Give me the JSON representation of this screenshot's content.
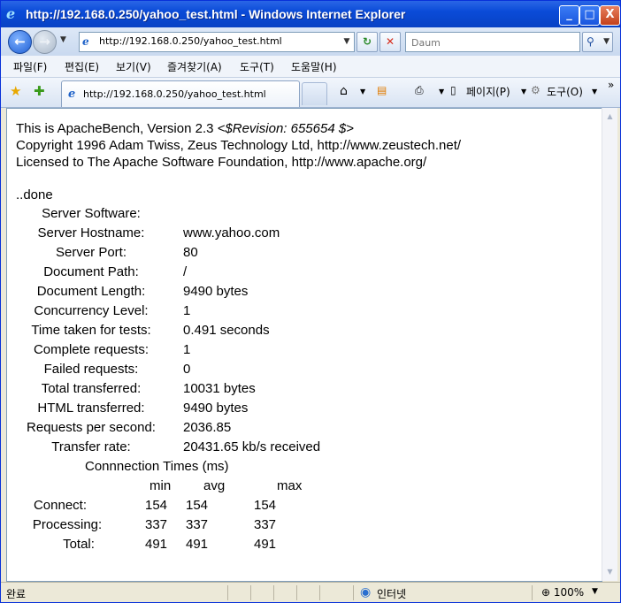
{
  "window": {
    "title": "http://192.168.0.250/yahoo_test.html - Windows Internet Explorer",
    "buttons": {
      "minimize": "_",
      "maximize": "□",
      "close": "X"
    }
  },
  "address_bar": {
    "url": "http://192.168.0.250/yahoo_test.html",
    "search_placeholder": "Daum"
  },
  "menu": [
    "파일(F)",
    "편집(E)",
    "보기(V)",
    "즐겨찾기(A)",
    "도구(T)",
    "도움말(H)"
  ],
  "tab": {
    "label": "http://192.168.0.250/yahoo_test.html"
  },
  "toolbar": {
    "page": "페이지(P)",
    "tools": "도구(O)",
    "more": "»"
  },
  "page": {
    "header": {
      "version_text": "This is ApacheBench, Version 2.3",
      "revision": "<$Revision: 655654 $>",
      "copyright": "Copyright 1996 Adam Twiss, Zeus Technology Ltd, http://www.zeustech.net/",
      "license": "Licensed to The Apache Software Foundation, http://www.apache.org/"
    },
    "done": "..done",
    "results": [
      {
        "label": "Server Software:",
        "value": ""
      },
      {
        "label": "Server Hostname:",
        "value": "www.yahoo.com"
      },
      {
        "label": "Server Port:",
        "value": "80"
      },
      {
        "label": "Document Path:",
        "value": "/"
      },
      {
        "label": "Document Length:",
        "value": "9490 bytes"
      },
      {
        "label": "Concurrency Level:",
        "value": "1"
      },
      {
        "label": "Time taken for tests:",
        "value": "0.491 seconds"
      },
      {
        "label": "Complete requests:",
        "value": "1"
      },
      {
        "label": "Failed requests:",
        "value": "0"
      },
      {
        "label": "Total transferred:",
        "value": "10031 bytes"
      },
      {
        "label": "HTML transferred:",
        "value": "9490 bytes"
      },
      {
        "label": "Requests per second:",
        "value": "2036.85"
      },
      {
        "label": "Transfer rate:",
        "value": "20431.65 kb/s received"
      }
    ],
    "connection_times": {
      "title": "Connnection Times (ms)",
      "columns": [
        "min",
        "avg",
        "max"
      ],
      "rows": [
        {
          "label": "Connect:",
          "min": "154",
          "avg": "154",
          "max": "154"
        },
        {
          "label": "Processing:",
          "min": "337",
          "avg": "337",
          "max": "337"
        },
        {
          "label": "Total:",
          "min": "491",
          "avg": "491",
          "max": "491"
        }
      ]
    }
  },
  "status_bar": {
    "status": "완료",
    "zone": "인터넷",
    "zoom": "100%"
  }
}
